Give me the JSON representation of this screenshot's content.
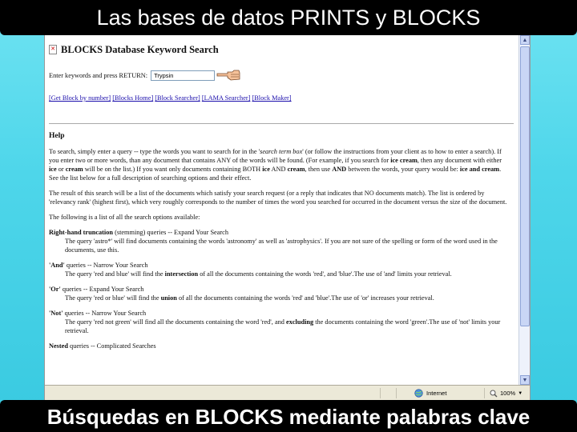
{
  "slide": {
    "title": "Las bases de datos PRINTS y BLOCKS",
    "caption": "Búsquedas en BLOCKS mediante palabras clave"
  },
  "page": {
    "broken_image_icon": "broken-image-icon",
    "heading": "BLOCKS Database Keyword Search",
    "search_prompt": "Enter keywords and press RETURN:",
    "search_value": "Trypsin",
    "pointer_icon": "pointing-hand-icon",
    "links": [
      "[Get Block by number]",
      "[Blocks Home]",
      "[Block Searcher]",
      "[LAMA Searcher]",
      "[Block Maker]"
    ],
    "help_title": "Help",
    "help": {
      "p1_a": "To search, simply enter a query -- type the words you want to search for in the '",
      "p1_em": "search term box",
      "p1_b": "' (or follow the instructions from your client as to how to enter a search). If you enter two or more words, than any document that contains ANY of the words will be found. (For example, if you search for ",
      "p1_k1": "ice cream",
      "p1_c": ", then any document with either ",
      "p1_k2": "ice",
      "p1_d": " or ",
      "p1_k3": "cream",
      "p1_e": " will be on the list.) If you want only documents containing BOTH ",
      "p1_k4": "ice",
      "p1_f": " AND ",
      "p1_k5": "cream",
      "p1_g": ", then use ",
      "p1_k6": "AND",
      "p1_h": " between the words, your query would be: ",
      "p1_k7": "ice and cream",
      "p1_i": ". See the list below for a full description of searching options and their effect.",
      "p2": "The result of this search will be a list of the documents which satisfy your search request (or a reply that indicates that NO documents match). The list is ordered by 'relevancy rank' (highest first), which very roughly corresponds to the number of times the word you searched for occurred in the document versus the size of the document.",
      "p3": "The following is a list of all the search options available:",
      "opt1_k": "Right-hand truncation",
      "opt1_t": " (stemming) queries -- Expand Your Search",
      "opt1_body": "The query 'astro*' will find documents containing the words 'astronomy' as well as 'astrophysics'. If you are not sure of the spelling or form of the word used in the documents, use this.",
      "opt2_k": "'And'",
      "opt2_t": " queries -- Narrow Your Search",
      "opt2_a": "The query 'red and blue' will find the ",
      "opt2_k2": "intersection",
      "opt2_b": " of all the documents containing the words 'red', and 'blue'.The use of 'and' limits your retrieval.",
      "opt3_k": "'Or'",
      "opt3_t": " queries -- Expand Your Search",
      "opt3_a": "The query 'red or blue' will find the ",
      "opt3_k2": "union",
      "opt3_b": " of all the documents containing the words 'red' and 'blue'.The use of 'or' increases your retrieval.",
      "opt4_k": "'Not'",
      "opt4_t": " queries -- Narrow Your Search",
      "opt4_a": "The query 'red not green' will find all the documents containing the word 'red', and ",
      "opt4_k2": "excluding",
      "opt4_b": " the documents containing the word 'green'.The use of 'not' limits your retrieval.",
      "opt5_k": "Nested",
      "opt5_t": " queries -- Complicated Searches"
    }
  },
  "statusbar": {
    "zone_label": "Internet",
    "zoom": "100%",
    "zone_icon": "globe-icon",
    "zoom_icon": "magnifier-icon"
  }
}
